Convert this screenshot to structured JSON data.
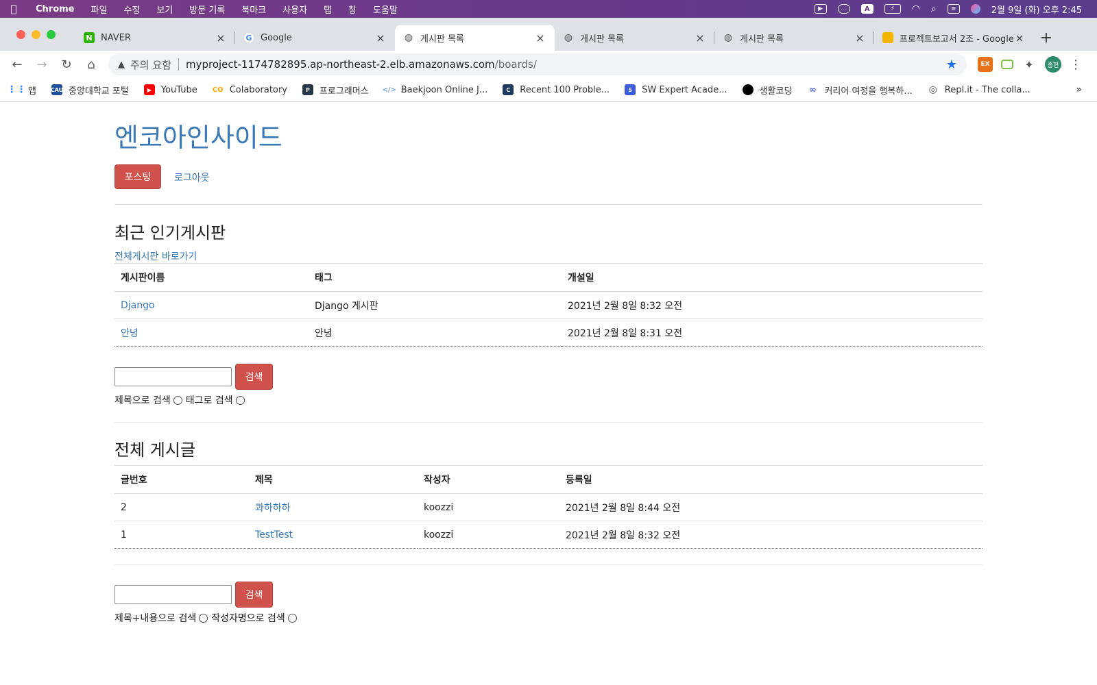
{
  "menubar": {
    "app": "Chrome",
    "items": [
      "파일",
      "수정",
      "보기",
      "방문 기록",
      "북마크",
      "사용자",
      "탭",
      "창",
      "도움말"
    ],
    "clock": "2월 9일 (화) 오후 2:45"
  },
  "tabs": [
    {
      "title": "NAVER",
      "favicon": "N",
      "color": "#2db400"
    },
    {
      "title": "Google",
      "favicon": "G",
      "color": "#4285f4"
    },
    {
      "title": "게시판 목록",
      "favicon": "globe",
      "color": "#555555"
    },
    {
      "title": "게시판 목록",
      "favicon": "globe",
      "color": "#555555"
    },
    {
      "title": "게시판 목록",
      "favicon": "globe",
      "color": "#555555"
    },
    {
      "title": "프로젝트보고서 2조 - Google",
      "favicon": "slides",
      "color": "#f4b400"
    }
  ],
  "toolbar": {
    "warning": "주의 요함",
    "url_host": "myproject-1174782895.ap-northeast-2.elb.amazonaws.com",
    "url_path": "/boards/",
    "ext1": "EX",
    "avatar": "종현"
  },
  "bookmarks": [
    {
      "label": "앱",
      "icon": "apps",
      "color": "#4285f4"
    },
    {
      "label": "중앙대학교 포털",
      "icon": "CAU",
      "color": "#1d4f9c"
    },
    {
      "label": "YouTube",
      "icon": "▶",
      "color": "#ff0000"
    },
    {
      "label": "Colaboratory",
      "icon": "CO",
      "color": "#f9ab00"
    },
    {
      "label": "프로그래머스",
      "icon": "P",
      "color": "#263747"
    },
    {
      "label": "Baekjoon Online J...",
      "icon": "</>",
      "color": "#6fa8dc"
    },
    {
      "label": "Recent 100 Proble...",
      "icon": "C",
      "color": "#1f3a5f"
    },
    {
      "label": "SW Expert Acade...",
      "icon": "S",
      "color": "#3b5bdb"
    },
    {
      "label": "생활코딩",
      "icon": "●",
      "color": "#000000"
    },
    {
      "label": "커리어 여정을 행복하...",
      "icon": "∞",
      "color": "#4f6bed"
    },
    {
      "label": "Repl.it - The colla...",
      "icon": "◎",
      "color": "#555555"
    }
  ],
  "bookmarks_more": "»",
  "page": {
    "brand": "엔코아인사이드",
    "post_button": "포스팅",
    "logout_link": "로그아웃",
    "popular": {
      "title": "최근 인기게시판",
      "all_link": "전체게시판 바로가기",
      "headers": [
        "게시판이름",
        "태그",
        "개설일"
      ],
      "rows": [
        [
          "Django",
          "Django 게시판",
          "2021년 2월 8일 8:32 오전"
        ],
        [
          "안녕",
          "안녕",
          "2021년 2월 8일 8:31 오전"
        ]
      ]
    },
    "search1": {
      "button": "검색",
      "option1": "제목으로 검색",
      "option2": "태그로 검색"
    },
    "posts": {
      "title": "전체 게시글",
      "headers": [
        "글번호",
        "제목",
        "작성자",
        "등록일"
      ],
      "rows": [
        [
          "2",
          "콰하하하",
          "koozzi",
          "2021년 2월 8일 8:44 오전"
        ],
        [
          "1",
          "TestTest",
          "koozzi",
          "2021년 2월 8일 8:32 오전"
        ]
      ]
    },
    "search2": {
      "button": "검색",
      "option1": "제목+내용으로 검색",
      "option2": "작성자명으로 검색"
    }
  }
}
